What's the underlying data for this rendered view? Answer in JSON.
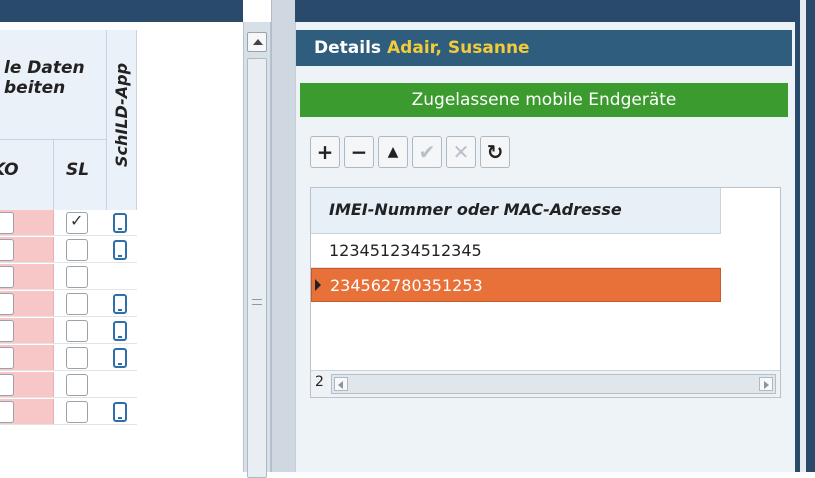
{
  "left_grid": {
    "group_header_line1": "le Daten",
    "group_header_line2": "beiten",
    "col_ko": "KO",
    "col_sl": "SL",
    "col_app": "SchILD-App",
    "rows": [
      {
        "sl_checked": true,
        "has_app": true
      },
      {
        "sl_checked": false,
        "has_app": true
      },
      {
        "sl_checked": false,
        "has_app": false
      },
      {
        "sl_checked": false,
        "has_app": true
      },
      {
        "sl_checked": false,
        "has_app": true
      },
      {
        "sl_checked": false,
        "has_app": true
      },
      {
        "sl_checked": false,
        "has_app": false
      },
      {
        "sl_checked": false,
        "has_app": true
      }
    ]
  },
  "details": {
    "title": "Details",
    "name": "Adair, Susanne",
    "banner": "Zugelassene mobile Endgeräte",
    "toolbar": {
      "add_icon": "+",
      "remove_icon": "−",
      "up_icon": "▲",
      "confirm_icon": "✔",
      "cancel_icon": "✕",
      "refresh_icon": "↻"
    },
    "grid": {
      "column_header": "IMEI-Nummer oder MAC-Adresse",
      "rows": [
        "123451234512345",
        "234562780351253"
      ],
      "selected_index": 1,
      "count": "2"
    }
  },
  "colors": {
    "header_bar": "#2e5d7e",
    "name_accent": "#f2cb3a",
    "banner_green": "#3b9b2e",
    "selection": "#e8713a",
    "pink_cells": "#f7c6c6"
  }
}
